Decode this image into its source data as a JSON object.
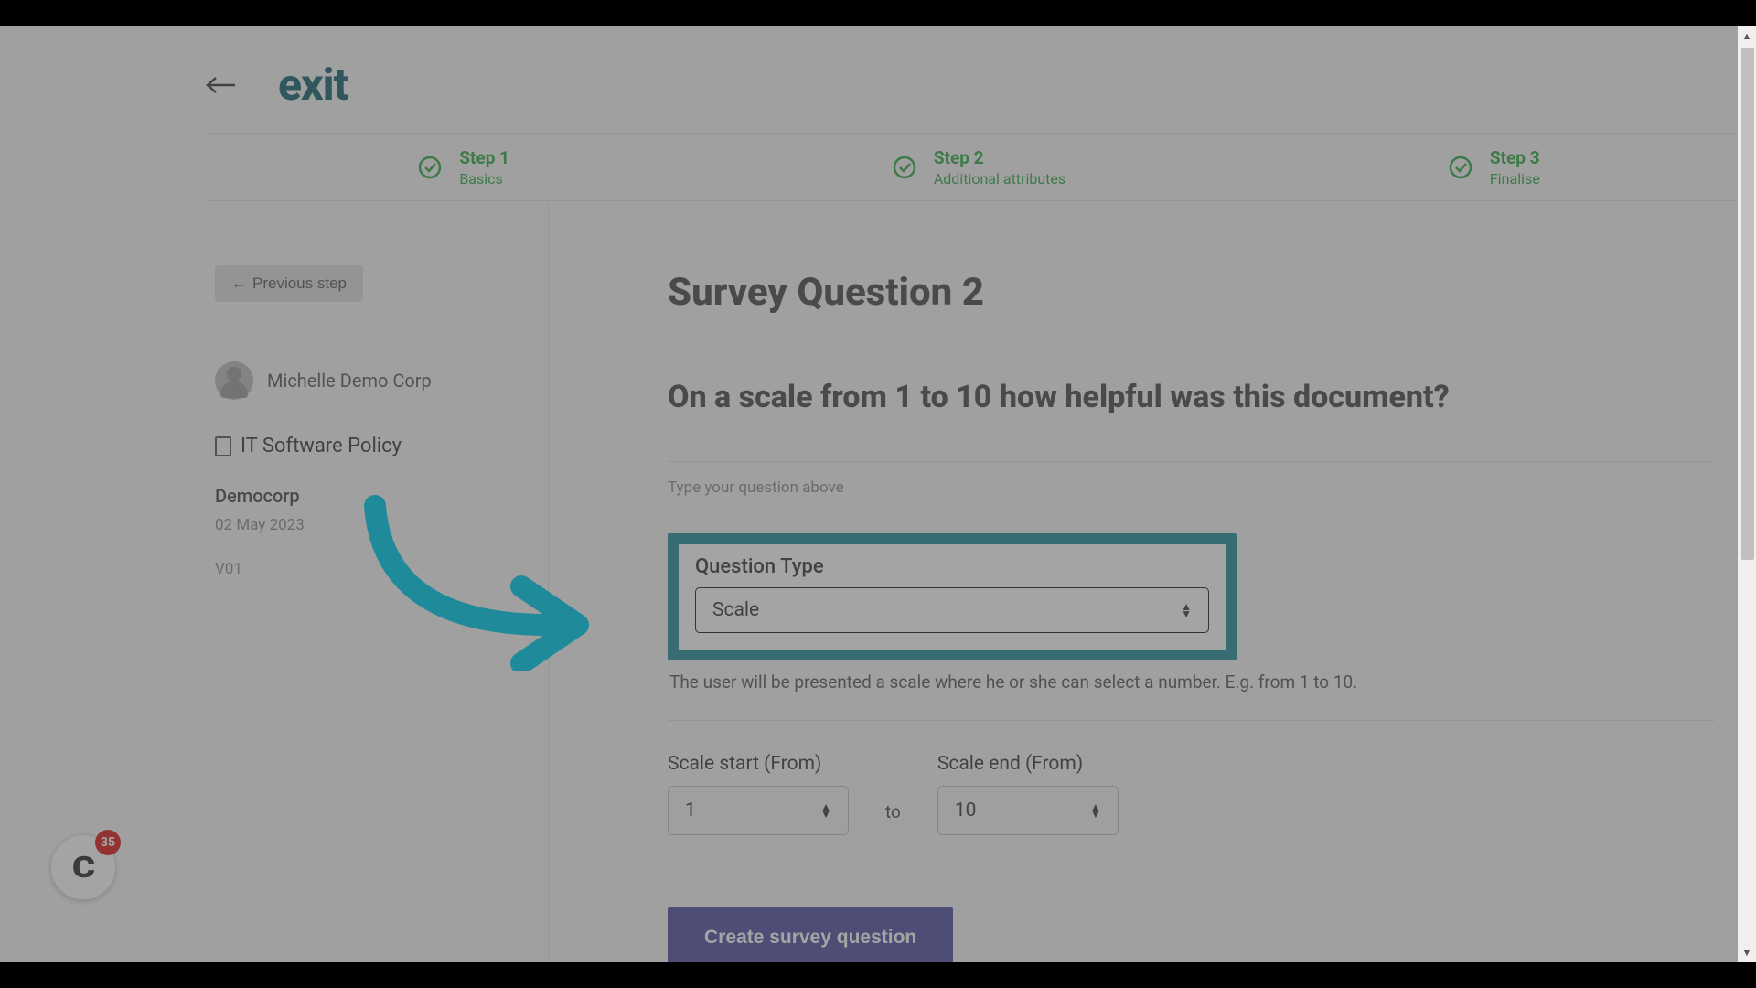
{
  "header": {
    "exit_label": "exit"
  },
  "steps": [
    {
      "title": "Step 1",
      "sub": "Basics"
    },
    {
      "title": "Step 2",
      "sub": "Additional attributes"
    },
    {
      "title": "Step 3",
      "sub": "Finalise"
    }
  ],
  "sidebar": {
    "prev_label": "Previous step",
    "owner_name": "Michelle Demo Corp",
    "doc_name": "IT Software Policy",
    "company": "Democorp",
    "date": "02 May 2023",
    "version": "V01"
  },
  "main": {
    "title": "Survey Question 2",
    "question": "On a scale from 1 to 10 how helpful was this document?",
    "hint": "Type your question above",
    "qt_label": "Question Type",
    "qt_value": "Scale",
    "qt_desc": "The user will be presented a scale where he or she can select a number. E.g. from 1 to 10.",
    "scale_start_label": "Scale start (From)",
    "scale_start_value": "1",
    "to_label": "to",
    "scale_end_label": "Scale end (From)",
    "scale_end_value": "10",
    "create_label": "Create survey question"
  },
  "badge": {
    "count": "35"
  },
  "colors": {
    "accent": "#1f8a9a",
    "step_green": "#2aa83f",
    "button_primary": "#4a4aa0"
  }
}
